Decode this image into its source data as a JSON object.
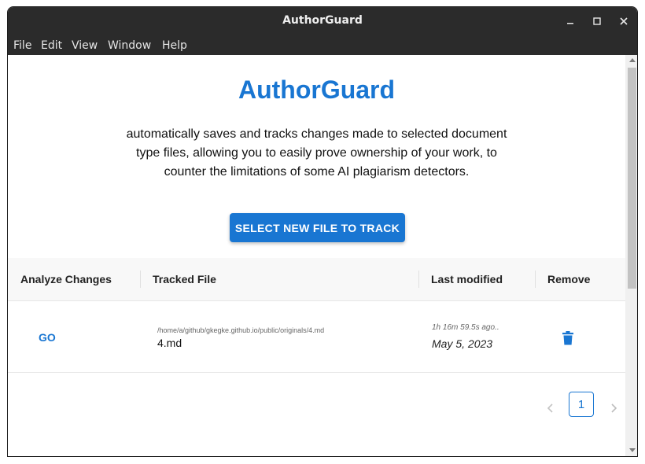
{
  "window": {
    "title": "AuthorGuard"
  },
  "menu": [
    "File",
    "Edit",
    "View",
    "Window",
    "Help"
  ],
  "app": {
    "heading": "AuthorGuard",
    "description": "automatically saves and tracks changes made to selected document type files, allowing you to easily prove ownership of your work, to counter the limitations of some AI plagiarism detectors.",
    "select_button": "SELECT NEW FILE TO TRACK",
    "accent_color": "#1976d2"
  },
  "table": {
    "columns": [
      "Analyze Changes",
      "Tracked File",
      "Last modified",
      "Remove"
    ],
    "rows": [
      {
        "action": "GO",
        "path": "/home/a/github/gkegke.github.io/public/originals/4.md",
        "file": "4.md",
        "ago": "1h 16m 59.5s ago..",
        "date": "May 5, 2023",
        "remove_icon": "trash-icon"
      }
    ]
  },
  "pagination": {
    "current_page": "1",
    "prev_icon": "chevron-left-icon",
    "next_icon": "chevron-right-icon"
  }
}
